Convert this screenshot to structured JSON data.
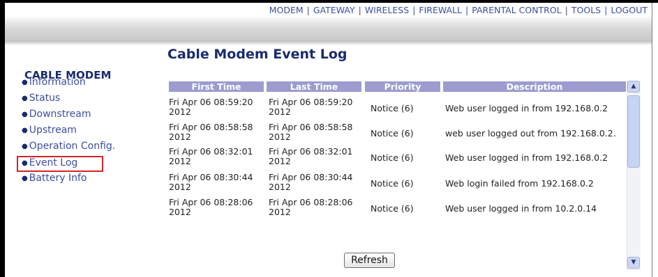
{
  "topnav": {
    "items": [
      "MODEM",
      "GATEWAY",
      "WIRELESS",
      "FIREWALL",
      "PARENTAL CONTROL",
      "TOOLS",
      "LOGOUT"
    ],
    "separator": "|"
  },
  "sidebar": {
    "title": "CABLE MODEM",
    "bullet": "●",
    "items": [
      {
        "label": "Information"
      },
      {
        "label": "Status"
      },
      {
        "label": "Downstream"
      },
      {
        "label": "Upstream"
      },
      {
        "label": "Operation Config."
      },
      {
        "label": "Event Log"
      },
      {
        "label": "Battery Info"
      }
    ],
    "selected": "Event Log"
  },
  "main": {
    "title": "Cable Modem Event Log",
    "table": {
      "headers": [
        "First Time",
        "Last Time",
        "Priority",
        "Description"
      ],
      "rows": [
        {
          "first_l1": "Fri Apr 06 08:59:20",
          "first_l2": "2012",
          "last_l1": "Fri Apr 06 08:59:20",
          "last_l2": "2012",
          "priority": "Notice (6)",
          "description": "Web user logged in from 192.168.0.2"
        },
        {
          "first_l1": "Fri Apr 06 08:58:58",
          "first_l2": "2012",
          "last_l1": "Fri Apr 06 08:58:58",
          "last_l2": "2012",
          "priority": "Notice (6)",
          "description": "web user logged out from 192.168.0.2."
        },
        {
          "first_l1": "Fri Apr 06 08:32:01",
          "first_l2": "2012",
          "last_l1": "Fri Apr 06 08:32:01",
          "last_l2": "2012",
          "priority": "Notice (6)",
          "description": "Web user logged in from 192.168.0.2"
        },
        {
          "first_l1": "Fri Apr 06 08:30:44",
          "first_l2": "2012",
          "last_l1": "Fri Apr 06 08:30:44",
          "last_l2": "2012",
          "priority": "Notice (6)",
          "description": "Web login failed from 192.168.0.2"
        },
        {
          "first_l1": "Fri Apr 06 08:28:06",
          "first_l2": "2012",
          "last_l1": "Fri Apr 06 08:28:06",
          "last_l2": "2012",
          "priority": "Notice (6)",
          "description": "Web user logged in from 10.2.0.14"
        }
      ]
    },
    "refresh_label": "Refresh"
  },
  "scrollbar": {
    "up_icon": "▲",
    "down_icon": "▼"
  },
  "colors": {
    "nav_text": "#3c4ea0",
    "title_text": "#1a2b6e",
    "table_header_bg": "#9c9cd0",
    "highlight_border": "#d1242a"
  }
}
